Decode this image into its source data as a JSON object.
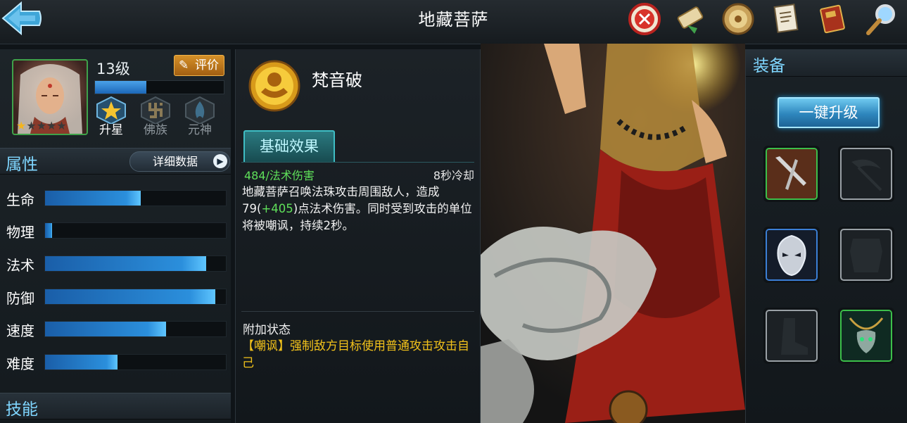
{
  "header": {
    "title": "地藏菩萨",
    "icons": [
      "back-arrow-icon",
      "battle-seal-icon",
      "scroll-icon",
      "coin-medal-icon",
      "document-icon",
      "book-icon",
      "magnifier-icon"
    ]
  },
  "hero": {
    "level": "13级",
    "exp_fraction": 0.4,
    "stars_filled": 1,
    "stars_total": 5,
    "eval_label": "评价",
    "badges": [
      "升星",
      "佛族",
      "元神"
    ]
  },
  "attributes": {
    "title": "属性",
    "detail_button": "详细数据",
    "items": [
      {
        "label": "生命",
        "value": 0.53
      },
      {
        "label": "物理",
        "value": 0.04
      },
      {
        "label": "法术",
        "value": 0.89
      },
      {
        "label": "防御",
        "value": 0.94
      },
      {
        "label": "速度",
        "value": 0.67
      },
      {
        "label": "难度",
        "value": 0.4
      }
    ]
  },
  "skills": {
    "title": "技能"
  },
  "skill_detail": {
    "name": "梵音破",
    "tab_label": "基础效果",
    "damage": "484/法术伤害",
    "cooldown": "8秒冷却",
    "desc_part1": "地藏菩萨召唤法珠攻击周围敌人，造成79(",
    "desc_bonus": "+405",
    "desc_part2": ")点法术伤害。同时受到攻击的单位将被嘲讽，持续2秒。",
    "addon_title": "附加状态",
    "addon_text": "【嘲讽】强制敌方目标使用普通攻击攻击自己"
  },
  "equipment": {
    "title": "装备",
    "upgrade_button": "一键升级",
    "slots": [
      "dagger-icon",
      "scythe-icon",
      "mask-icon",
      "armor-icon",
      "boots-icon",
      "necklace-icon"
    ]
  },
  "colors": {
    "accent_blue": "#7fd6ff",
    "bar_blue": "#2b8fdc",
    "green_text": "#5fe05a",
    "yellow_text": "#f2c21b",
    "eval_orange": "#d59028"
  }
}
